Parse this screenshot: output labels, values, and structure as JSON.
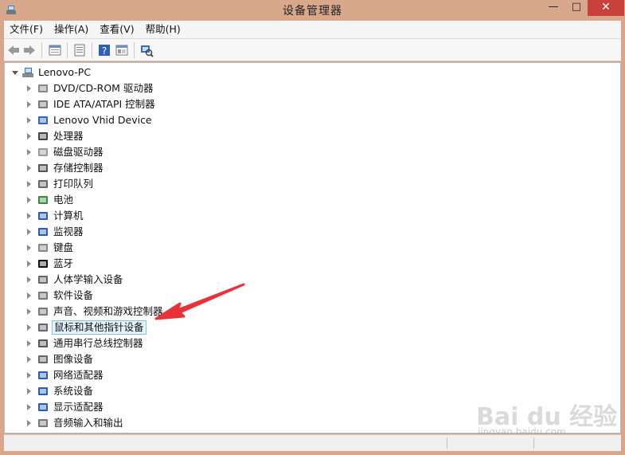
{
  "window": {
    "title": "设备管理器",
    "min": "—",
    "max": "□",
    "close": "✕"
  },
  "menu": [
    "文件(F)",
    "操作(A)",
    "查看(V)",
    "帮助(H)"
  ],
  "toolbar": {
    "back": "◀",
    "forward": "▶"
  },
  "tree": {
    "root": "Lenovo-PC",
    "items": [
      {
        "label": "DVD/CD-ROM 驱动器",
        "icon": "dvd-drive-icon",
        "color": "#888"
      },
      {
        "label": "IDE ATA/ATAPI 控制器",
        "icon": "ide-controller-icon",
        "color": "#777"
      },
      {
        "label": "Lenovo Vhid Device",
        "icon": "hid-device-icon",
        "color": "#2a6ab0"
      },
      {
        "label": "处理器",
        "icon": "processor-icon",
        "color": "#444"
      },
      {
        "label": "磁盘驱动器",
        "icon": "disk-drive-icon",
        "color": "#999"
      },
      {
        "label": "存储控制器",
        "icon": "storage-controller-icon",
        "color": "#555"
      },
      {
        "label": "打印队列",
        "icon": "printer-icon",
        "color": "#666"
      },
      {
        "label": "电池",
        "icon": "battery-icon",
        "color": "#3a8a3a"
      },
      {
        "label": "计算机",
        "icon": "computer-icon",
        "color": "#2a5fa8"
      },
      {
        "label": "监视器",
        "icon": "monitor-icon",
        "color": "#2a5fa8"
      },
      {
        "label": "键盘",
        "icon": "keyboard-icon",
        "color": "#888"
      },
      {
        "label": "蓝牙",
        "icon": "bluetooth-icon",
        "color": "#111"
      },
      {
        "label": "人体学输入设备",
        "icon": "human-interface-icon",
        "color": "#666"
      },
      {
        "label": "软件设备",
        "icon": "software-device-icon",
        "color": "#777"
      },
      {
        "label": "声音、视频和游戏控制器",
        "icon": "speaker-icon",
        "color": "#777"
      },
      {
        "label": "鼠标和其他指针设备",
        "icon": "mouse-icon",
        "color": "#666",
        "selected": true
      },
      {
        "label": "通用串行总线控制器",
        "icon": "usb-icon",
        "color": "#555"
      },
      {
        "label": "图像设备",
        "icon": "camera-icon",
        "color": "#666"
      },
      {
        "label": "网络适配器",
        "icon": "network-adapter-icon",
        "color": "#2a5fa8"
      },
      {
        "label": "系统设备",
        "icon": "system-device-icon",
        "color": "#2a5fa8"
      },
      {
        "label": "显示适配器",
        "icon": "display-adapter-icon",
        "color": "#2a5fa8"
      },
      {
        "label": "音频输入和输出",
        "icon": "audio-io-icon",
        "color": "#777"
      }
    ]
  },
  "annotation": {
    "arrow_color": "#e8323a"
  },
  "watermark": {
    "main": "Bai du 经验",
    "sub": "jingyan.baidu.com"
  }
}
